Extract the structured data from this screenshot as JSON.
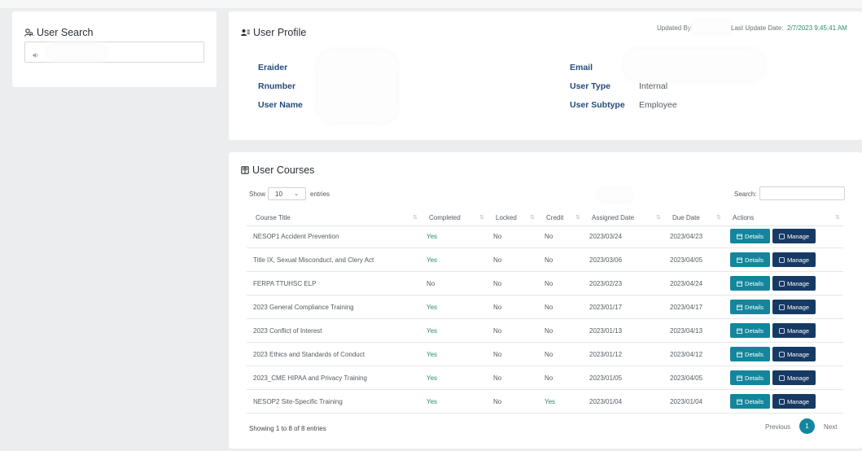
{
  "user_search": {
    "title": "User Search"
  },
  "profile": {
    "title": "User Profile",
    "updated_by_label": "Updated By:",
    "last_update_label": "Last Update Date:",
    "last_update_value": "2/7/2023 9:45:41 AM",
    "fields_left": [
      {
        "label": "Eraider",
        "value": ""
      },
      {
        "label": "Rnumber",
        "value": ""
      },
      {
        "label": "User Name",
        "value": ""
      }
    ],
    "fields_right": [
      {
        "label": "Email",
        "value": ""
      },
      {
        "label": "User Type",
        "value": "Internal"
      },
      {
        "label": "User Subtype",
        "value": "Employee"
      }
    ]
  },
  "courses": {
    "title": "User Courses",
    "show_label": "Show",
    "entries_value": "10",
    "entries_label": "entries",
    "search_label": "Search:",
    "columns": [
      "Course Title",
      "Completed",
      "Locked",
      "Credit",
      "Assigned Date",
      "Due Date",
      "Actions"
    ],
    "details_label": "Details",
    "manage_label": "Manage",
    "rows": [
      {
        "title": "NESOP1 Accident Prevention",
        "completed": "Yes",
        "locked": "No",
        "credit": "No",
        "assigned": "2023/03/24",
        "due": "2023/04/23"
      },
      {
        "title": "Title IX, Sexual Misconduct, and Clery Act",
        "completed": "Yes",
        "locked": "No",
        "credit": "No",
        "assigned": "2023/03/06",
        "due": "2023/04/05"
      },
      {
        "title": "FERPA TTUHSC ELP",
        "completed": "No",
        "locked": "No",
        "credit": "No",
        "assigned": "2023/02/23",
        "due": "2023/04/24"
      },
      {
        "title": "2023 General Compliance Training",
        "completed": "Yes",
        "locked": "No",
        "credit": "No",
        "assigned": "2023/01/17",
        "due": "2023/04/17"
      },
      {
        "title": "2023 Conflict of Interest",
        "completed": "Yes",
        "locked": "No",
        "credit": "No",
        "assigned": "2023/01/13",
        "due": "2023/04/13"
      },
      {
        "title": "2023 Ethics and Standards of Conduct",
        "completed": "Yes",
        "locked": "No",
        "credit": "No",
        "assigned": "2023/01/12",
        "due": "2023/04/12"
      },
      {
        "title": "2023_CME HIPAA and Privacy Training",
        "completed": "Yes",
        "locked": "No",
        "credit": "No",
        "assigned": "2023/01/05",
        "due": "2023/04/05"
      },
      {
        "title": "NESOP2 Site-Specific Training",
        "completed": "Yes",
        "locked": "No",
        "credit": "Yes",
        "assigned": "2023/01/04",
        "due": "2023/01/04"
      }
    ],
    "footer_info": "Showing 1 to 8 of 8 entries",
    "pagination": {
      "previous": "Previous",
      "current": "1",
      "next": "Next"
    }
  },
  "colors": {
    "accent_teal": "#13869d",
    "accent_navy": "#163a63",
    "label_blue": "#234b7a",
    "yes_green": "#2e8a6c"
  }
}
